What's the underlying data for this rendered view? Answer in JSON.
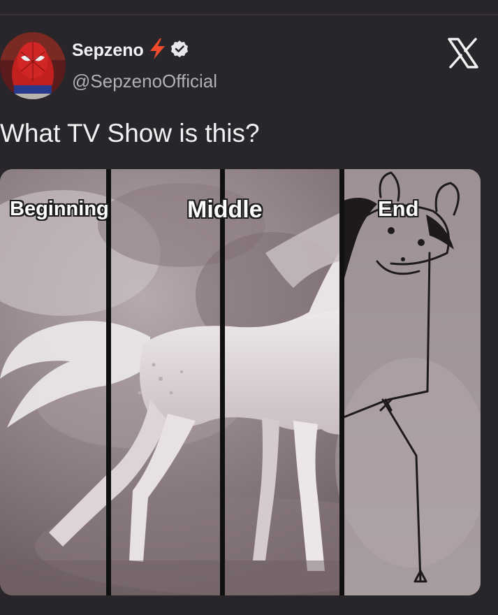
{
  "tweet": {
    "author": {
      "display_name": "Sepzeno",
      "handle": "@SepzenoOfficial",
      "badge_icon": "lightning-bolt-icon",
      "verified_icon": "verified-badge-icon"
    },
    "platform_icon": "x-logo-icon",
    "text": "What TV Show is this?"
  },
  "meme": {
    "panel_labels": [
      "Beginning",
      "Middle",
      "End"
    ],
    "panel_count": 4
  },
  "colors": {
    "background": "#28262b",
    "text_primary": "#f2f2f2",
    "text_secondary": "#aeb1b7",
    "bolt": "#f04a2c"
  }
}
